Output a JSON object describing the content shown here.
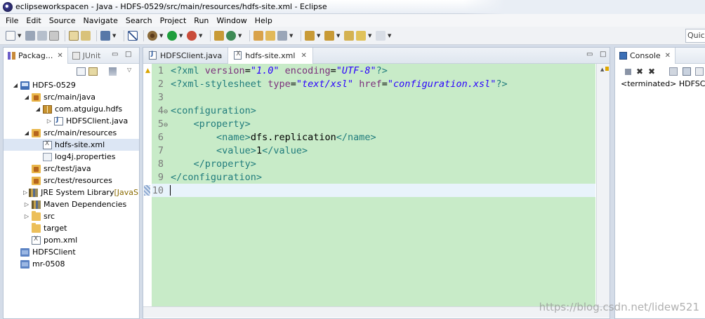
{
  "window": {
    "title": "eclipseworkspacen - Java - HDFS-0529/src/main/resources/hdfs-site.xml - Eclipse"
  },
  "menubar": {
    "items": [
      "File",
      "Edit",
      "Source",
      "Navigate",
      "Search",
      "Project",
      "Run",
      "Window",
      "Help"
    ]
  },
  "toolbar": {
    "quick_access": "Quick Access"
  },
  "package_explorer": {
    "tab_label": "Packag...",
    "second_tab_label": "JUnit",
    "tree": [
      {
        "label": "HDFS-0529",
        "icon": "project-icon",
        "toggle": "expanded"
      },
      {
        "label": "src/main/java",
        "icon": "source-folder-icon",
        "toggle": "expanded"
      },
      {
        "label": "com.atguigu.hdfs",
        "icon": "package-icon",
        "toggle": "expanded"
      },
      {
        "label": "HDFSClient.java",
        "icon": "java-file-icon",
        "toggle": "collapsed"
      },
      {
        "label": "src/main/resources",
        "icon": "source-folder-icon",
        "toggle": "expanded"
      },
      {
        "label": "hdfs-site.xml",
        "icon": "xml-file-icon",
        "toggle": "none",
        "selected": true
      },
      {
        "label": "log4j.properties",
        "icon": "properties-file-icon",
        "toggle": "none"
      },
      {
        "label": "src/test/java",
        "icon": "source-folder-icon",
        "toggle": "none"
      },
      {
        "label": "src/test/resources",
        "icon": "source-folder-icon",
        "toggle": "none"
      },
      {
        "label": "JRE System Library",
        "decoration": "[JavaSE",
        "icon": "library-icon",
        "toggle": "collapsed"
      },
      {
        "label": "Maven Dependencies",
        "icon": "library-icon",
        "toggle": "collapsed"
      },
      {
        "label": "src",
        "icon": "folder-icon",
        "toggle": "collapsed"
      },
      {
        "label": "target",
        "icon": "folder-icon",
        "toggle": "none"
      },
      {
        "label": "pom.xml",
        "icon": "xml-file-icon",
        "toggle": "none"
      },
      {
        "label": "HDFSClient",
        "icon": "closed-project-icon",
        "toggle": "none"
      },
      {
        "label": "mr-0508",
        "icon": "closed-project-icon",
        "toggle": "none"
      }
    ]
  },
  "editor": {
    "tabs": [
      {
        "label": "HDFSClient.java",
        "active": false
      },
      {
        "label": "hdfs-site.xml",
        "active": true
      }
    ],
    "lines": [
      {
        "num": "1",
        "fold": "",
        "tokens": [
          {
            "t": "<?",
            "c": "tag"
          },
          {
            "t": "xml",
            "c": "tag"
          },
          {
            "t": " version",
            "c": "att"
          },
          {
            "t": "=",
            "c": "txt"
          },
          {
            "t": "\"1.0\"",
            "c": "str"
          },
          {
            "t": " encoding",
            "c": "att"
          },
          {
            "t": "=",
            "c": "txt"
          },
          {
            "t": "\"UTF-8\"",
            "c": "str"
          },
          {
            "t": "?>",
            "c": "tag"
          }
        ]
      },
      {
        "num": "2",
        "fold": "",
        "tokens": [
          {
            "t": "<?",
            "c": "tag"
          },
          {
            "t": "xml-stylesheet",
            "c": "tag"
          },
          {
            "t": " type",
            "c": "att"
          },
          {
            "t": "=",
            "c": "txt"
          },
          {
            "t": "\"text/xsl\"",
            "c": "str"
          },
          {
            "t": " href",
            "c": "att"
          },
          {
            "t": "=",
            "c": "txt"
          },
          {
            "t": "\"configuration.xsl\"",
            "c": "str"
          },
          {
            "t": "?>",
            "c": "tag"
          }
        ]
      },
      {
        "num": "3",
        "fold": "",
        "tokens": []
      },
      {
        "num": "4",
        "fold": "⊖",
        "tokens": [
          {
            "t": "<configuration>",
            "c": "tag"
          }
        ]
      },
      {
        "num": "5",
        "fold": "⊖",
        "tokens": [
          {
            "t": "    ",
            "c": "txt"
          },
          {
            "t": "<property>",
            "c": "tag"
          }
        ]
      },
      {
        "num": "6",
        "fold": "",
        "tokens": [
          {
            "t": "        ",
            "c": "txt"
          },
          {
            "t": "<name>",
            "c": "tag"
          },
          {
            "t": "dfs.replication",
            "c": "txt"
          },
          {
            "t": "</name>",
            "c": "tag"
          }
        ]
      },
      {
        "num": "7",
        "fold": "",
        "tokens": [
          {
            "t": "        ",
            "c": "txt"
          },
          {
            "t": "<value>",
            "c": "tag"
          },
          {
            "t": "1",
            "c": "txt"
          },
          {
            "t": "</value>",
            "c": "tag"
          }
        ]
      },
      {
        "num": "8",
        "fold": "",
        "tokens": [
          {
            "t": "    ",
            "c": "txt"
          },
          {
            "t": "</property>",
            "c": "tag"
          }
        ]
      },
      {
        "num": "9",
        "fold": "",
        "tokens": [
          {
            "t": "</configuration>",
            "c": "tag"
          }
        ]
      },
      {
        "num": "10",
        "fold": "",
        "tokens": []
      }
    ]
  },
  "console": {
    "tab_label": "Console",
    "status": "<terminated> HDFSClient"
  },
  "watermark": "https://blog.csdn.net/lidew521",
  "colors": {
    "editor_background": "#c8ebc8",
    "current_line": "#e8f3fb",
    "xml_tag": "#207c7c",
    "xml_attribute": "#7b2f7b",
    "xml_string": "#2a00ff"
  }
}
